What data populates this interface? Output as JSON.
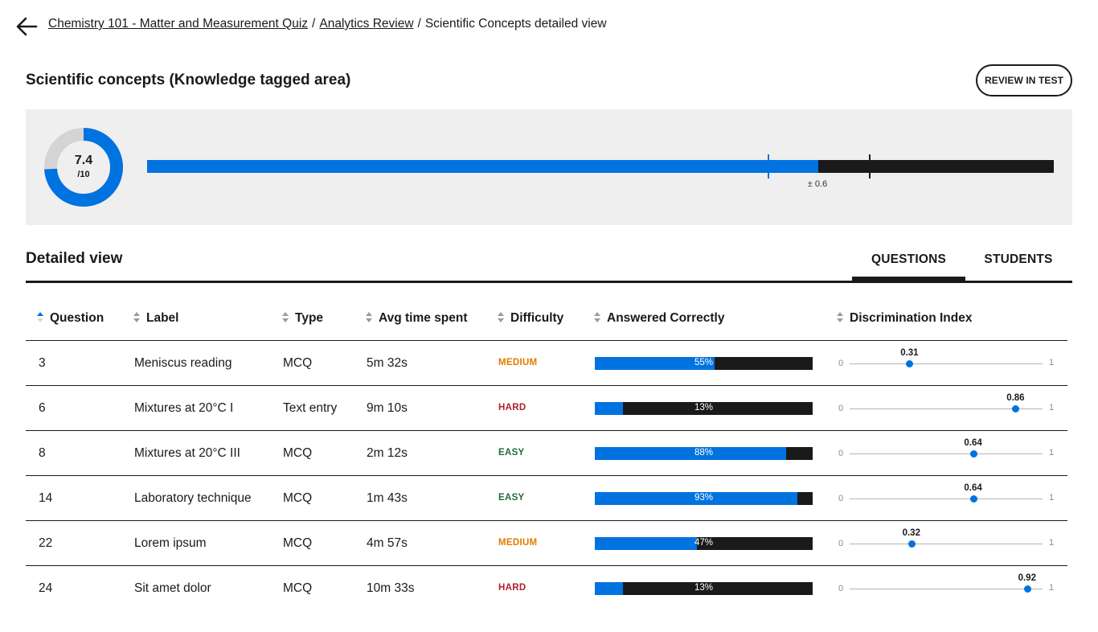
{
  "breadcrumb": {
    "items": [
      "Chemistry 101 - Matter and Measurement Quiz",
      "Analytics Review"
    ],
    "current": "Scientific Concepts detailed view",
    "separator": "/"
  },
  "header": {
    "title": "Scientific concepts (Knowledge tagged area)",
    "review_button": "REVIEW IN TEST"
  },
  "score": {
    "value": "7.4",
    "total": "/10",
    "margin_label": "± 0.6",
    "bar_fill_fraction": 0.74,
    "lower_marker_fraction": 0.684,
    "upper_marker_fraction": 0.796,
    "colors": {
      "accent": "#0073e0",
      "remainder": "#1a1a1a",
      "donut_track": "#d4d4d4"
    }
  },
  "detailed": {
    "title": "Detailed view",
    "tabs": [
      {
        "label": "QUESTIONS",
        "active": true
      },
      {
        "label": "STUDENTS",
        "active": false
      }
    ]
  },
  "table": {
    "columns": [
      "Question",
      "Label",
      "Type",
      "Avg time spent",
      "Difficulty",
      "Answered Correctly",
      "Discrimination Index"
    ],
    "difficulty_colors": {
      "MEDIUM": "#e07b00",
      "HARD": "#b0202e",
      "EASY": "#1f6b3a"
    },
    "di_scale": {
      "min": "0",
      "max": "1"
    },
    "rows": [
      {
        "question": "3",
        "label": "Meniscus reading",
        "type": "MCQ",
        "time": "5m 32s",
        "difficulty": "MEDIUM",
        "correct": 0.55,
        "correct_label": "55%",
        "di": 0.31,
        "di_label": "0.31"
      },
      {
        "question": "6",
        "label": "Mixtures at 20°C I",
        "type": "Text entry",
        "time": "9m 10s",
        "difficulty": "HARD",
        "correct": 0.13,
        "correct_label": "13%",
        "di": 0.86,
        "di_label": "0.86"
      },
      {
        "question": "8",
        "label": "Mixtures at 20°C III",
        "type": "MCQ",
        "time": "2m 12s",
        "difficulty": "EASY",
        "correct": 0.88,
        "correct_label": "88%",
        "di": 0.64,
        "di_label": "0.64"
      },
      {
        "question": "14",
        "label": "Laboratory technique",
        "type": "MCQ",
        "time": "1m 43s",
        "difficulty": "EASY",
        "correct": 0.93,
        "correct_label": "93%",
        "di": 0.64,
        "di_label": "0.64"
      },
      {
        "question": "22",
        "label": "Lorem ipsum",
        "type": "MCQ",
        "time": "4m 57s",
        "difficulty": "MEDIUM",
        "correct": 0.47,
        "correct_label": "47%",
        "di": 0.32,
        "di_label": "0.32"
      },
      {
        "question": "24",
        "label": "Sit amet dolor",
        "type": "MCQ",
        "time": "10m 33s",
        "difficulty": "HARD",
        "correct": 0.13,
        "correct_label": "13%",
        "di": 0.92,
        "di_label": "0.92"
      }
    ]
  }
}
